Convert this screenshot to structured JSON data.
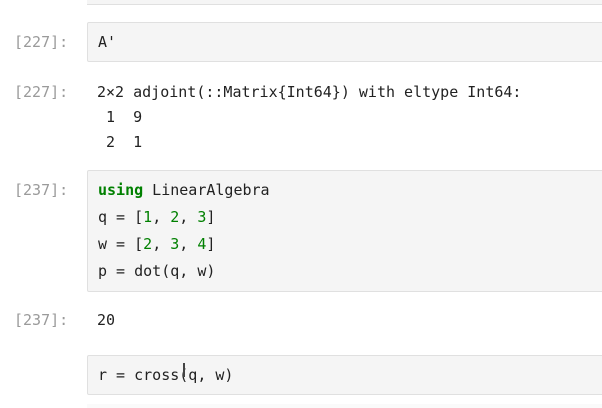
{
  "cells": [
    {
      "prompt": "[227]:",
      "input": "A'"
    },
    {
      "prompt": "[227]:",
      "output_header": "2×2 adjoint(::Matrix{Int64}) with eltype Int64:",
      "output_rows": [
        " 1  9",
        " 2  1"
      ]
    },
    {
      "prompt": "[237]:",
      "code": {
        "line1_kw": "using",
        "line1_rest": " LinearAlgebra",
        "line2_a": "q = [",
        "line2_n1": "1",
        "line2_b": ", ",
        "line2_n2": "2",
        "line2_c": ", ",
        "line2_n3": "3",
        "line2_d": "]",
        "line3_a": "w = [",
        "line3_n1": "2",
        "line3_b": ", ",
        "line3_n2": "3",
        "line3_c": ", ",
        "line3_n3": "4",
        "line3_d": "]",
        "line4": "p = dot(q, w)"
      }
    },
    {
      "prompt": "[237]:",
      "output": "20"
    },
    {
      "prompt": "",
      "input": "r = cross(q, w)"
    }
  ]
}
